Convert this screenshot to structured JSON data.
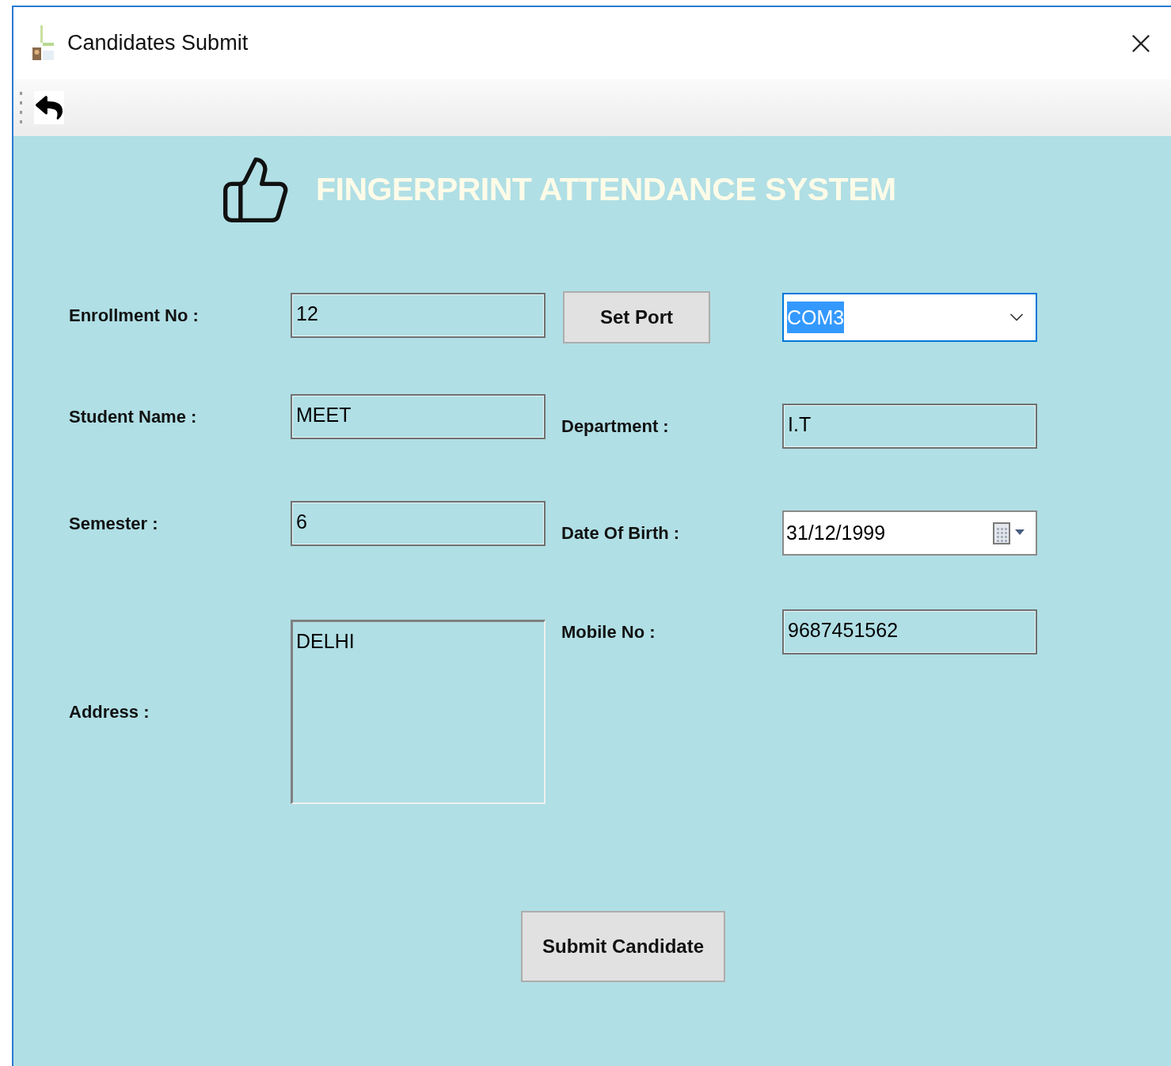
{
  "window": {
    "title": "Candidates Submit"
  },
  "header": {
    "title": "FINGERPRINT ATTENDANCE SYSTEM"
  },
  "left_fields": [
    {
      "label": "Enrollment No :",
      "kind": "text",
      "value": "12"
    },
    {
      "label": "Student Name :",
      "kind": "text",
      "value": "MEET"
    },
    {
      "label": "Semester :",
      "kind": "text",
      "value": "6"
    },
    {
      "label": "Address :",
      "kind": "textarea",
      "value": "DELHI"
    }
  ],
  "port": {
    "button": "Set Port",
    "value": "COM3",
    "highlighted": true
  },
  "right_fields": [
    {
      "label": "Department :",
      "kind": "text",
      "value": "I.T"
    },
    {
      "label": "Date Of Birth :",
      "kind": "date",
      "value": "31/12/1999"
    },
    {
      "label": "Mobile No :",
      "kind": "text",
      "value": "9687451562"
    }
  ],
  "submit_button": "Submit Candidate"
}
